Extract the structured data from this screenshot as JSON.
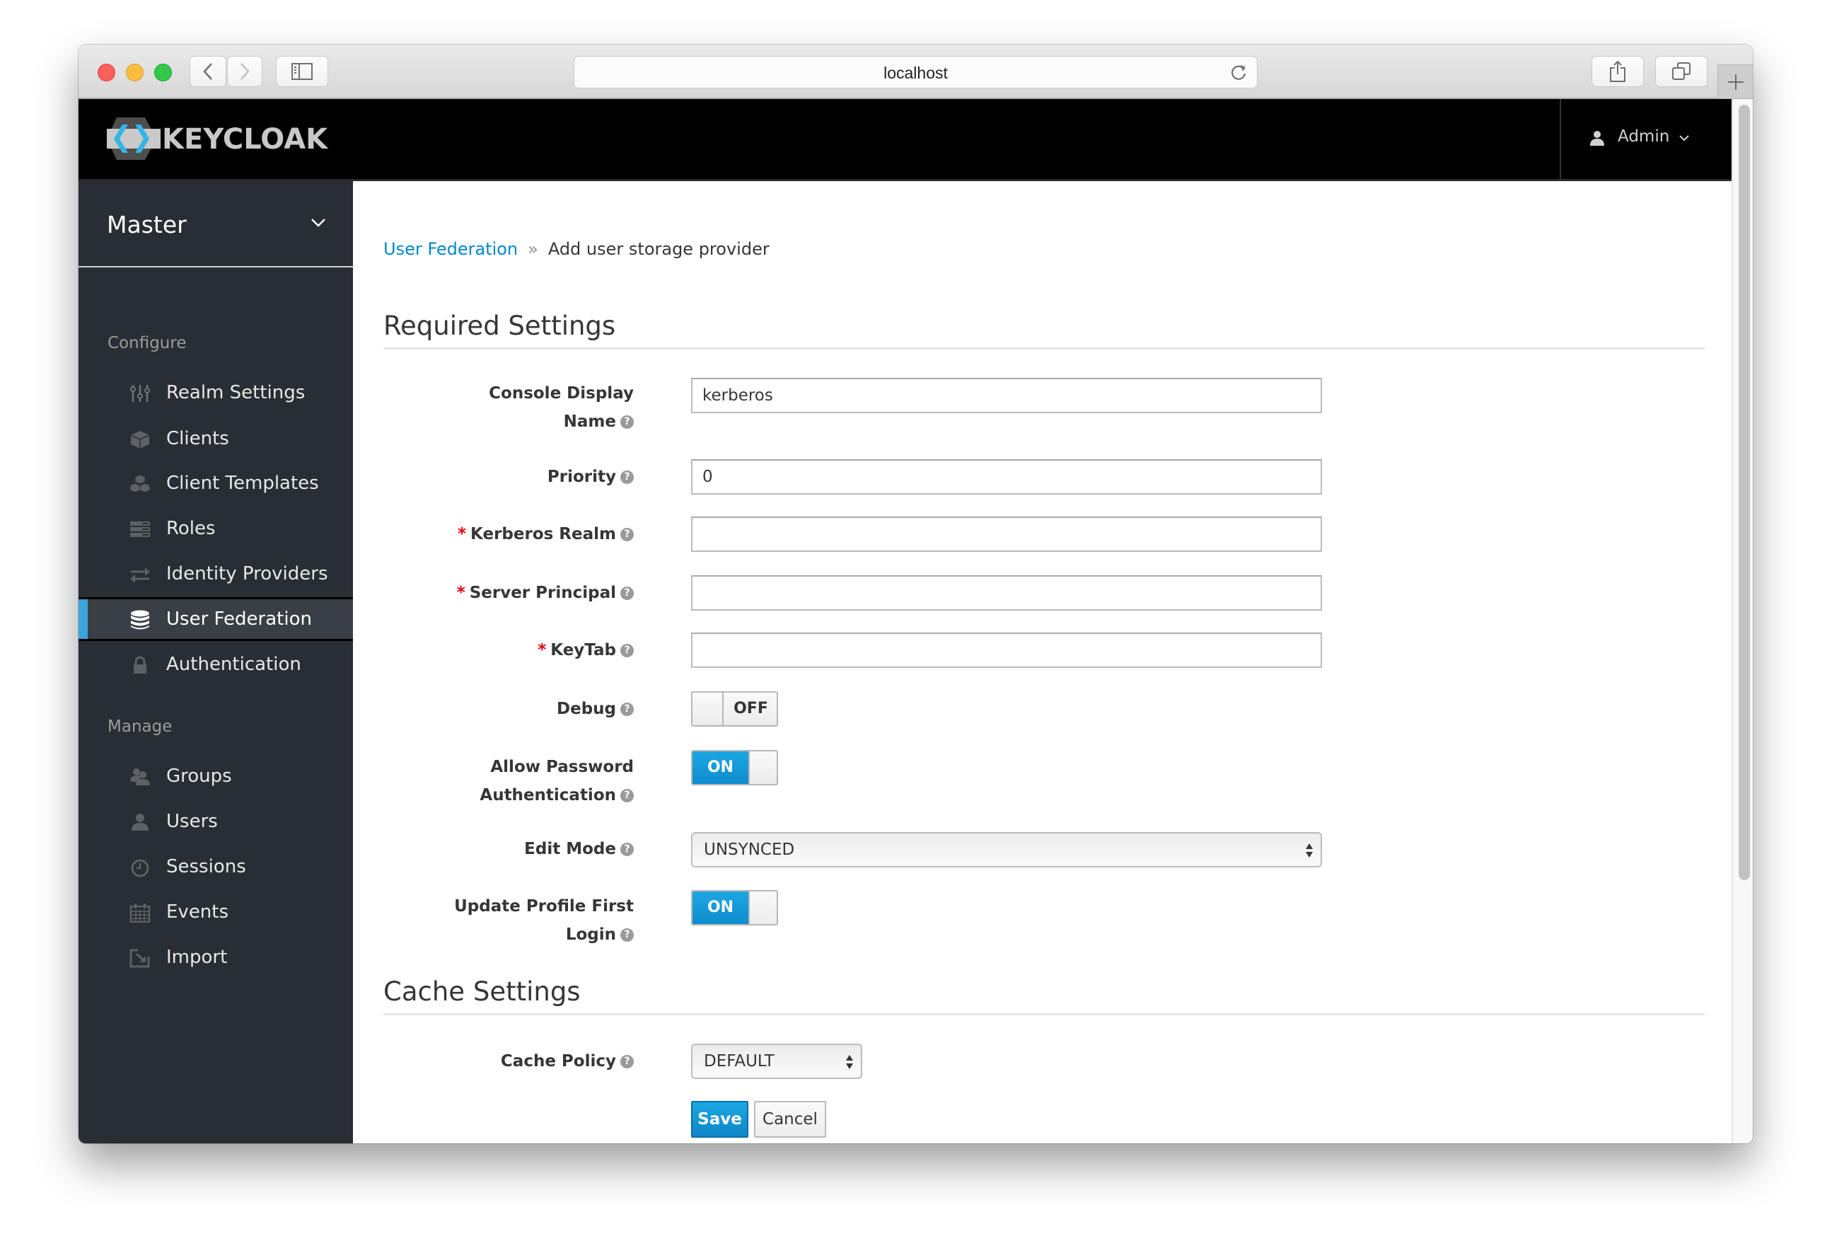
{
  "browser": {
    "url": "localhost",
    "traffic_lights": {
      "close": "#fc605c",
      "minimize": "#fdbc40",
      "zoom": "#34c84a"
    },
    "icons": [
      "back-icon",
      "forward-icon",
      "sidebar-icon",
      "reload-icon",
      "share-icon",
      "tabs-icon",
      "new-tab-icon"
    ]
  },
  "header": {
    "brand": "KEYCLOAK",
    "user": "Admin",
    "user_icon": "user-icon"
  },
  "sidebar": {
    "realm": "Master",
    "sections": [
      {
        "label": "Configure",
        "items": [
          {
            "label": "Realm Settings",
            "icon": "sliders-icon",
            "active": false
          },
          {
            "label": "Clients",
            "icon": "cube-icon",
            "active": false
          },
          {
            "label": "Client Templates",
            "icon": "cubes-icon",
            "active": false
          },
          {
            "label": "Roles",
            "icon": "list-icon",
            "active": false
          },
          {
            "label": "Identity Providers",
            "icon": "exchange-icon",
            "active": false
          },
          {
            "label": "User Federation",
            "icon": "database-icon",
            "active": true
          },
          {
            "label": "Authentication",
            "icon": "lock-icon",
            "active": false
          }
        ]
      },
      {
        "label": "Manage",
        "items": [
          {
            "label": "Groups",
            "icon": "users-icon",
            "active": false
          },
          {
            "label": "Users",
            "icon": "user-icon",
            "active": false
          },
          {
            "label": "Sessions",
            "icon": "clock-icon",
            "active": false
          },
          {
            "label": "Events",
            "icon": "calendar-icon",
            "active": false
          },
          {
            "label": "Import",
            "icon": "import-icon",
            "active": false
          }
        ]
      }
    ]
  },
  "breadcrumb": {
    "link": "User Federation",
    "separator": "»",
    "current": "Add user storage provider"
  },
  "form": {
    "required_title": "Required Settings",
    "fields": {
      "console_display_name": {
        "label_line1": "Console Display",
        "label_line2": "Name",
        "value": "kerberos"
      },
      "priority": {
        "label": "Priority",
        "value": "0"
      },
      "kerberos_realm": {
        "label": "Kerberos Realm",
        "required": "*",
        "value": ""
      },
      "server_principal": {
        "label": "Server Principal",
        "required": "*",
        "value": ""
      },
      "keytab": {
        "label": "KeyTab",
        "required": "*",
        "value": ""
      },
      "debug": {
        "label": "Debug",
        "state": "OFF"
      },
      "allow_password_auth": {
        "label_line1": "Allow Password",
        "label_line2": "Authentication",
        "state": "ON"
      },
      "edit_mode": {
        "label": "Edit Mode",
        "value": "UNSYNCED"
      },
      "update_profile_first_login": {
        "label_line1": "Update Profile First",
        "label_line2": "Login",
        "state": "ON"
      }
    },
    "cache_title": "Cache Settings",
    "cache_policy": {
      "label": "Cache Policy",
      "value": "DEFAULT"
    },
    "help_glyph": "?",
    "save_label": "Save",
    "cancel_label": "Cancel"
  },
  "colors": {
    "accent": "#0088ce",
    "toggle_on": "#1ca7e3",
    "sidebar_bg": "#292e34",
    "sidebar_active": "#393f44",
    "active_marker": "#39a5dc",
    "required": "#e8000f"
  }
}
